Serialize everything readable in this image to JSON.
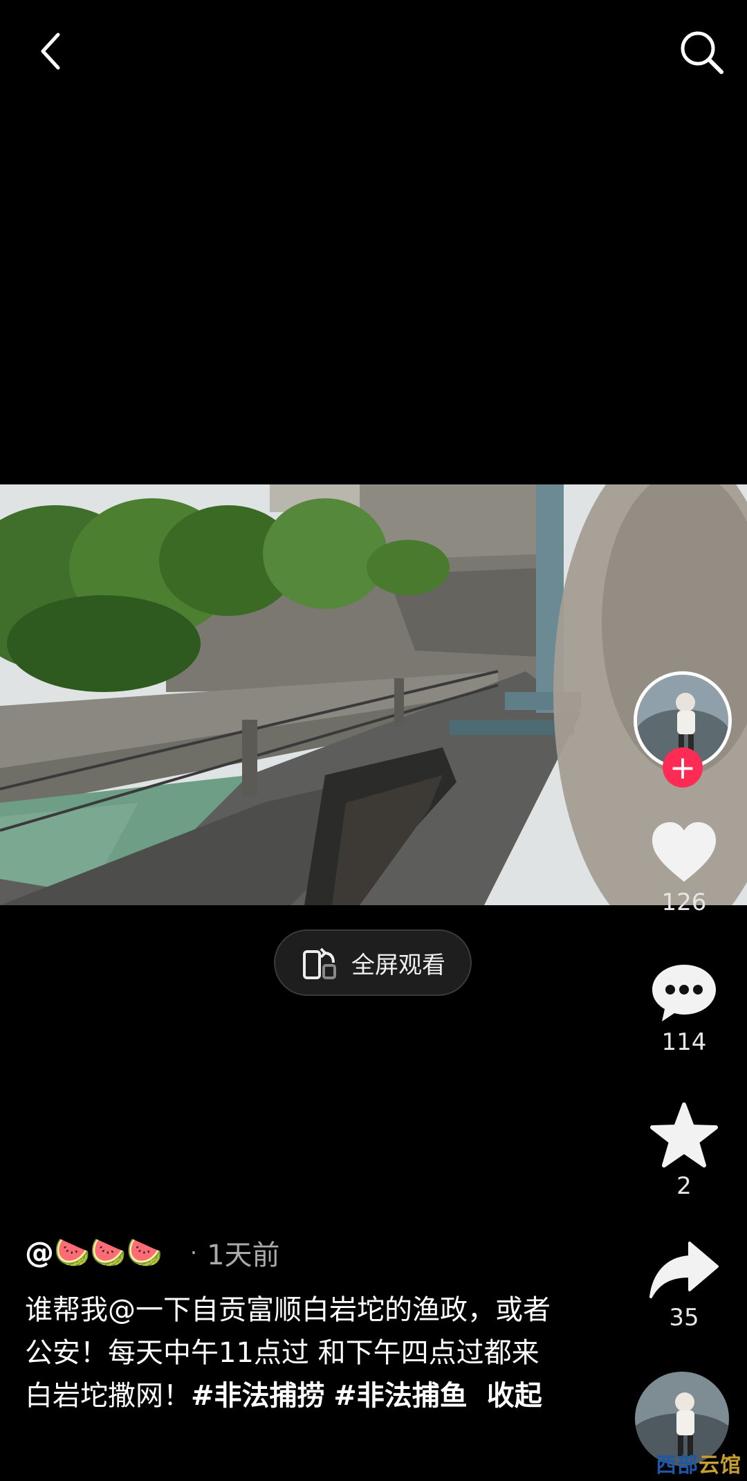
{
  "header": {
    "back_icon": "chevron-left-icon",
    "search_icon": "search-icon"
  },
  "player": {
    "fullscreen_label": "全屏观看",
    "fullscreen_icon": "rotate-phone-icon"
  },
  "rail": {
    "like_count": "126",
    "comment_count": "114",
    "favorite_count": "2",
    "share_count": "35",
    "follow_symbol": "+",
    "like_icon": "heart-icon",
    "comment_icon": "speech-bubble-icon",
    "favorite_icon": "star-icon",
    "share_icon": "share-arrow-icon"
  },
  "post": {
    "username": "@🍉🍉🍉",
    "separator": "·",
    "time": "1天前",
    "caption_text": "谁帮我@一下自贡富顺白岩坨的渔政，或者公安！每天中午11点过 和下午四点过都来白岩坨撒网！",
    "hashtags": [
      "#非法捕捞",
      "#非法捕鱼"
    ],
    "collapse_label": "收起"
  },
  "watermark": {
    "part1": "西部",
    "part2": "云馆"
  },
  "colors": {
    "background": "#000000",
    "accent": "#fe2c55"
  }
}
